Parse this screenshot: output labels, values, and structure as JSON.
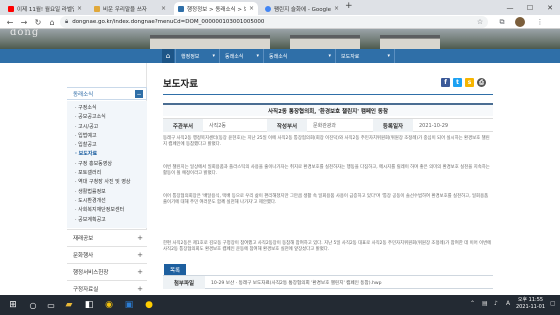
{
  "browser": {
    "tabs": [
      {
        "label": "이제 11월! 월요일 라벨입니다!",
        "favicon_color": "#ff0000",
        "active": false
      },
      {
        "label": "비운 우리말을 쓰자",
        "favicon_color": "#e0a83a",
        "active": false
      },
      {
        "label": "행정정보 > 동래소식 > 보도자료",
        "favicon_color": "#2f6fa8",
        "active": true
      },
      {
        "label": "팸린지 슬화에 - Google 검색",
        "favicon_color": "#4285f4",
        "active": false
      }
    ],
    "new_tab": "+",
    "url": "dongnae.go.kr/index.dongnae?menuCd=DOM_000000103001005000"
  },
  "site": {
    "banner_text": "dong",
    "home_glyph": "⌂",
    "breadcrumbs": [
      "행정정보",
      "동래소식",
      "동래소식",
      "보도자료"
    ],
    "sidebar": {
      "head": "동래소식",
      "items": [
        {
          "label": "· 구정소식",
          "selected": false
        },
        {
          "label": "· 공모공고소식",
          "selected": false
        },
        {
          "label": "· 고시/공고",
          "selected": false
        },
        {
          "label": "· 입법예고",
          "selected": false
        },
        {
          "label": "· 입찰공고",
          "selected": false
        },
        {
          "label": "· 보도자료",
          "selected": true
        },
        {
          "label": "· 구정 홍보동영상",
          "selected": false
        },
        {
          "label": "· 포토갤러리",
          "selected": false
        },
        {
          "label": "· 역대 구청장 사진 및 영상",
          "selected": false
        },
        {
          "label": "· 생활법률정보",
          "selected": false
        },
        {
          "label": "· 도시환경개선",
          "selected": false
        },
        {
          "label": "· 사회복지재단정보센터",
          "selected": false
        },
        {
          "label": "· 공보계획공고",
          "selected": false
        }
      ],
      "sections": [
        "재래공보",
        "문화행사",
        "행정서비스헌장",
        "구정자료실"
      ]
    },
    "page_title": "보도자료",
    "share": [
      {
        "name": "facebook",
        "glyph": "f",
        "color": "#3b5998"
      },
      {
        "name": "twitter",
        "glyph": "t",
        "color": "#1da1f2"
      },
      {
        "name": "kakaostory",
        "glyph": "s",
        "color": "#f7b500"
      },
      {
        "name": "print",
        "glyph": "⎙",
        "color": "#555555"
      }
    ],
    "article": {
      "title": "사직2동 통장협의회, '환경보호 챌린지' 캠페인 동참",
      "labels": {
        "dept": "주관부서",
        "writer": "작성부서",
        "date": "등록일자"
      },
      "dept": "사직2동",
      "writer": "문화관광과",
      "date": "2021-10-29",
      "paragraphs": [
        "동래구 사직2동 행정복지센터(동장 윤현호)는 지난 25일 이에 사직2동 통장협의회(회장 이진덕)와 사직2동 주민자치위원회(위원장 조정례)가 중심이 되어 실시하는 환경보호 챌린지 캠페인에 동참했다고 밝혔다.",
        "이번 챌린지는 일상에서 일회용품과 플라스틱의 사용을 줄이나가자는 취지로 환경보호를 실천하자는 행동을 다짐하고, 메시지를 릴레이 하며 좋은 의미의 환경보호 실천을 지속하는 활동이 될 예정이라고 밝혔다.",
        "이어 통장협의회장은 '배달용식, 택배 등으로 우리 삶이 편리해졌지만 그만큼 생활 속 일회용품 사용이 급증하고 있다'며 '통장 공동이 솔선수범하여 환경보호를 실천하고, 일회용품 줄이기에 대해 주민 여러분도 함께 실천해 나가자'고 제안했다.",
        "한편 사직2동은 제1호로 김모동 구청장이 참여했고 사직2동장이 동참해 참여하고 있다. 지난 5일 사직2동 대표로 사직2동 주민자치위원회(위원장 조정례)가 참여한 데 이어 이번에 사직2동 통장협의회도 환경보호 캠페인 운동에 참여해 환경보호 실천에 앞장섰다고 밝혔다."
      ]
    },
    "attachment": {
      "label": "첨부파일",
      "file": "10-29 보산 · 동래구 보도자료(사직2동 통장협의회 '환경보호 챌린지' 캠페인 동참).hwp"
    },
    "list_button": "목록"
  },
  "taskbar": {
    "clock_time": "오후 11:55",
    "clock_date": "2021-11-01",
    "ime": "A"
  }
}
